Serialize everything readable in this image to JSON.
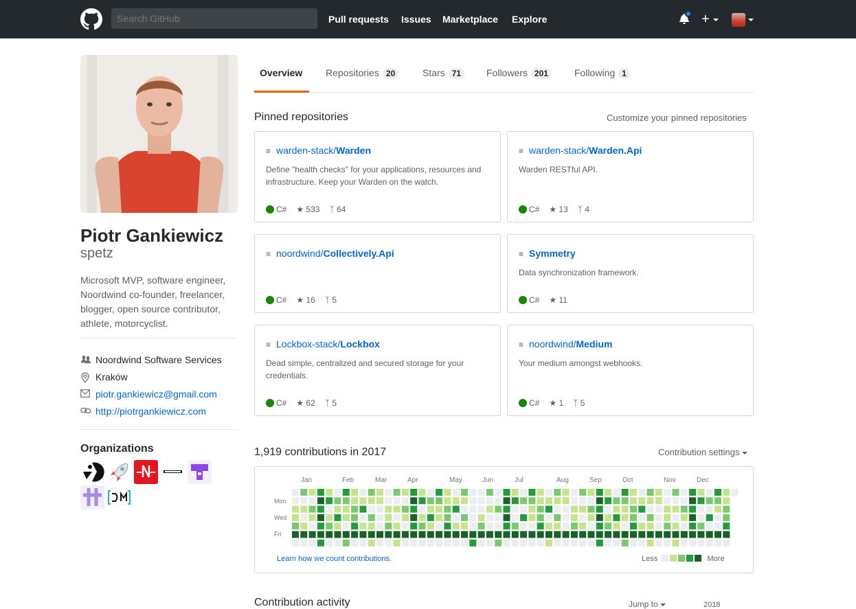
{
  "header": {
    "search_placeholder": "Search GitHub",
    "nav": [
      "Pull requests",
      "Issues",
      "Marketplace",
      "Explore"
    ],
    "plus": "+"
  },
  "profile": {
    "name": "Piotr Gankiewicz",
    "login": "spetz",
    "bio": "Microsoft MVP, software engineer, Noordwind co-founder, freelancer, blogger, open source contributor, athlete, motorcyclist.",
    "company": "Noordwind Software Services",
    "location": "Kraków",
    "email": "piotr.gankiewicz@gmail.com",
    "website": "http://piotrgankiewicz.com",
    "organizations_title": "Organizations"
  },
  "tabs": [
    {
      "label": "Overview",
      "count": ""
    },
    {
      "label": "Repositories",
      "count": "20"
    },
    {
      "label": "Stars",
      "count": "71"
    },
    {
      "label": "Followers",
      "count": "201"
    },
    {
      "label": "Following",
      "count": "1"
    }
  ],
  "pinned": {
    "title": "Pinned repositories",
    "customize": "Customize your pinned repositories",
    "repos": [
      {
        "owner": "warden-stack/",
        "name": "Warden",
        "desc": "Define \"health checks\" for your applications, resources and infrastructure. Keep your Warden on the watch.",
        "lang": "C#",
        "stars": "533",
        "forks": "64"
      },
      {
        "owner": "warden-stack/",
        "name": "Warden.Api",
        "desc": "Warden RESTful API.",
        "lang": "C#",
        "stars": "13",
        "forks": "4"
      },
      {
        "owner": "noordwind/",
        "name": "Collectively.Api",
        "desc": "",
        "lang": "C#",
        "stars": "16",
        "forks": "5"
      },
      {
        "owner": "",
        "name": "Symmetry",
        "desc": "Data synchronization framework.",
        "lang": "C#",
        "stars": "11",
        "forks": ""
      },
      {
        "owner": "Lockbox-stack/",
        "name": "Lockbox",
        "desc": "Dead simple, centralized and secured storage for your credentials.",
        "lang": "C#",
        "stars": "62",
        "forks": "5"
      },
      {
        "owner": "noordwind/",
        "name": "Medium",
        "desc": "Your medium amongst webhooks.",
        "lang": "C#",
        "stars": "1",
        "forks": "5"
      }
    ]
  },
  "contributions": {
    "title": "1,919 contributions in 2017",
    "settings": "Contribution settings",
    "months": [
      "Jan",
      "Feb",
      "Mar",
      "Apr",
      "May",
      "Jun",
      "Jul",
      "Aug",
      "Sep",
      "Oct",
      "Nov",
      "Dec"
    ],
    "weekdays": [
      "Mon",
      "Wed",
      "Fri"
    ],
    "learn": "Learn how we count contributions.",
    "less": "Less",
    "more": "More",
    "colors": [
      "#ebedf0",
      "#c6e48b",
      "#7bc96f",
      "#239a3b",
      "#196127"
    ]
  },
  "activity": {
    "title": "Contribution activity",
    "jump": "Jump to",
    "year": "2018"
  }
}
